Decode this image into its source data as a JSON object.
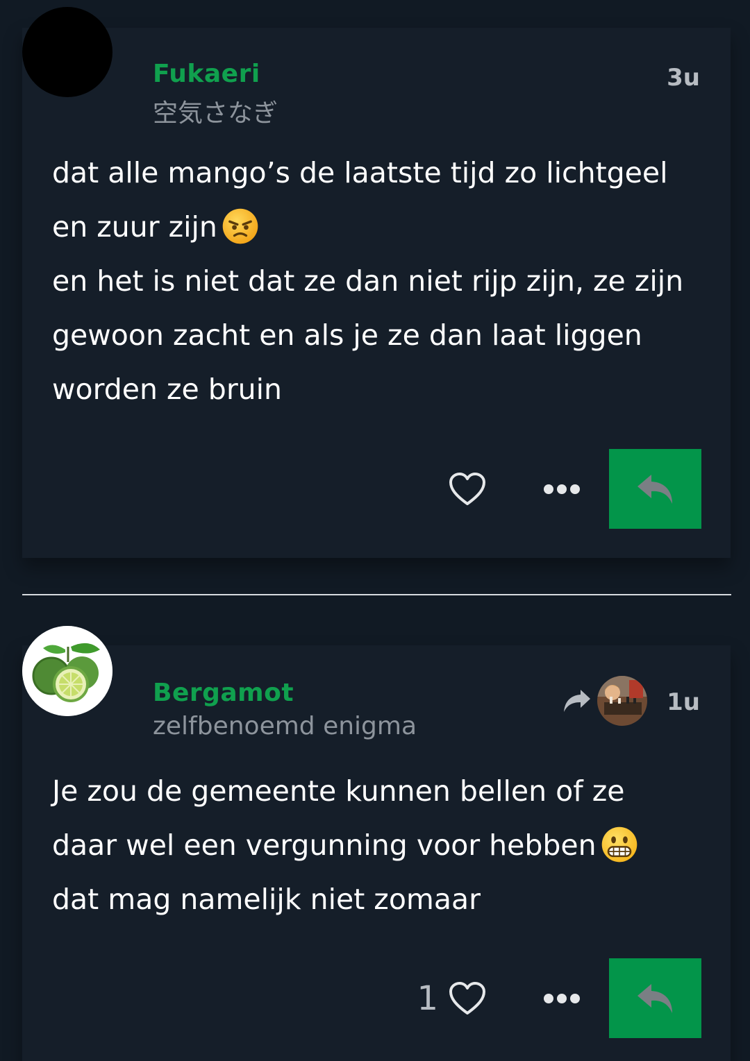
{
  "posts": [
    {
      "username": "Fukaeri",
      "tagline": "空気さなぎ",
      "time": "3u",
      "lines": [
        "dat alle mango’s de laatste tijd zo lichtgeel",
        "en zuur zijn",
        "en het is niet dat ze dan niet rijp zijn, ze zijn",
        "gewoon zacht en als je ze dan laat liggen",
        "worden ze bruin"
      ],
      "emoji": "angry-face",
      "likes": ""
    },
    {
      "username": "Bergamot",
      "tagline": "zelfbenoemd enigma",
      "time": "1u",
      "lines": [
        "Je zou de gemeente kunnen bellen of ze",
        "daar wel een vergunning voor hebben",
        "dat mag namelijk niet zomaar"
      ],
      "emoji": "grimacing-face",
      "likes": "1"
    }
  ],
  "icons": {
    "like": "heart-outline-icon",
    "more": "ellipsis-icon",
    "reply": "reply-arrow-icon",
    "reblog": "share-arrow-icon"
  },
  "colors": {
    "background": "#111a24",
    "card": "#151e29",
    "username": "#10a04e",
    "reply_button": "#03954a",
    "muted": "#8d949c"
  }
}
